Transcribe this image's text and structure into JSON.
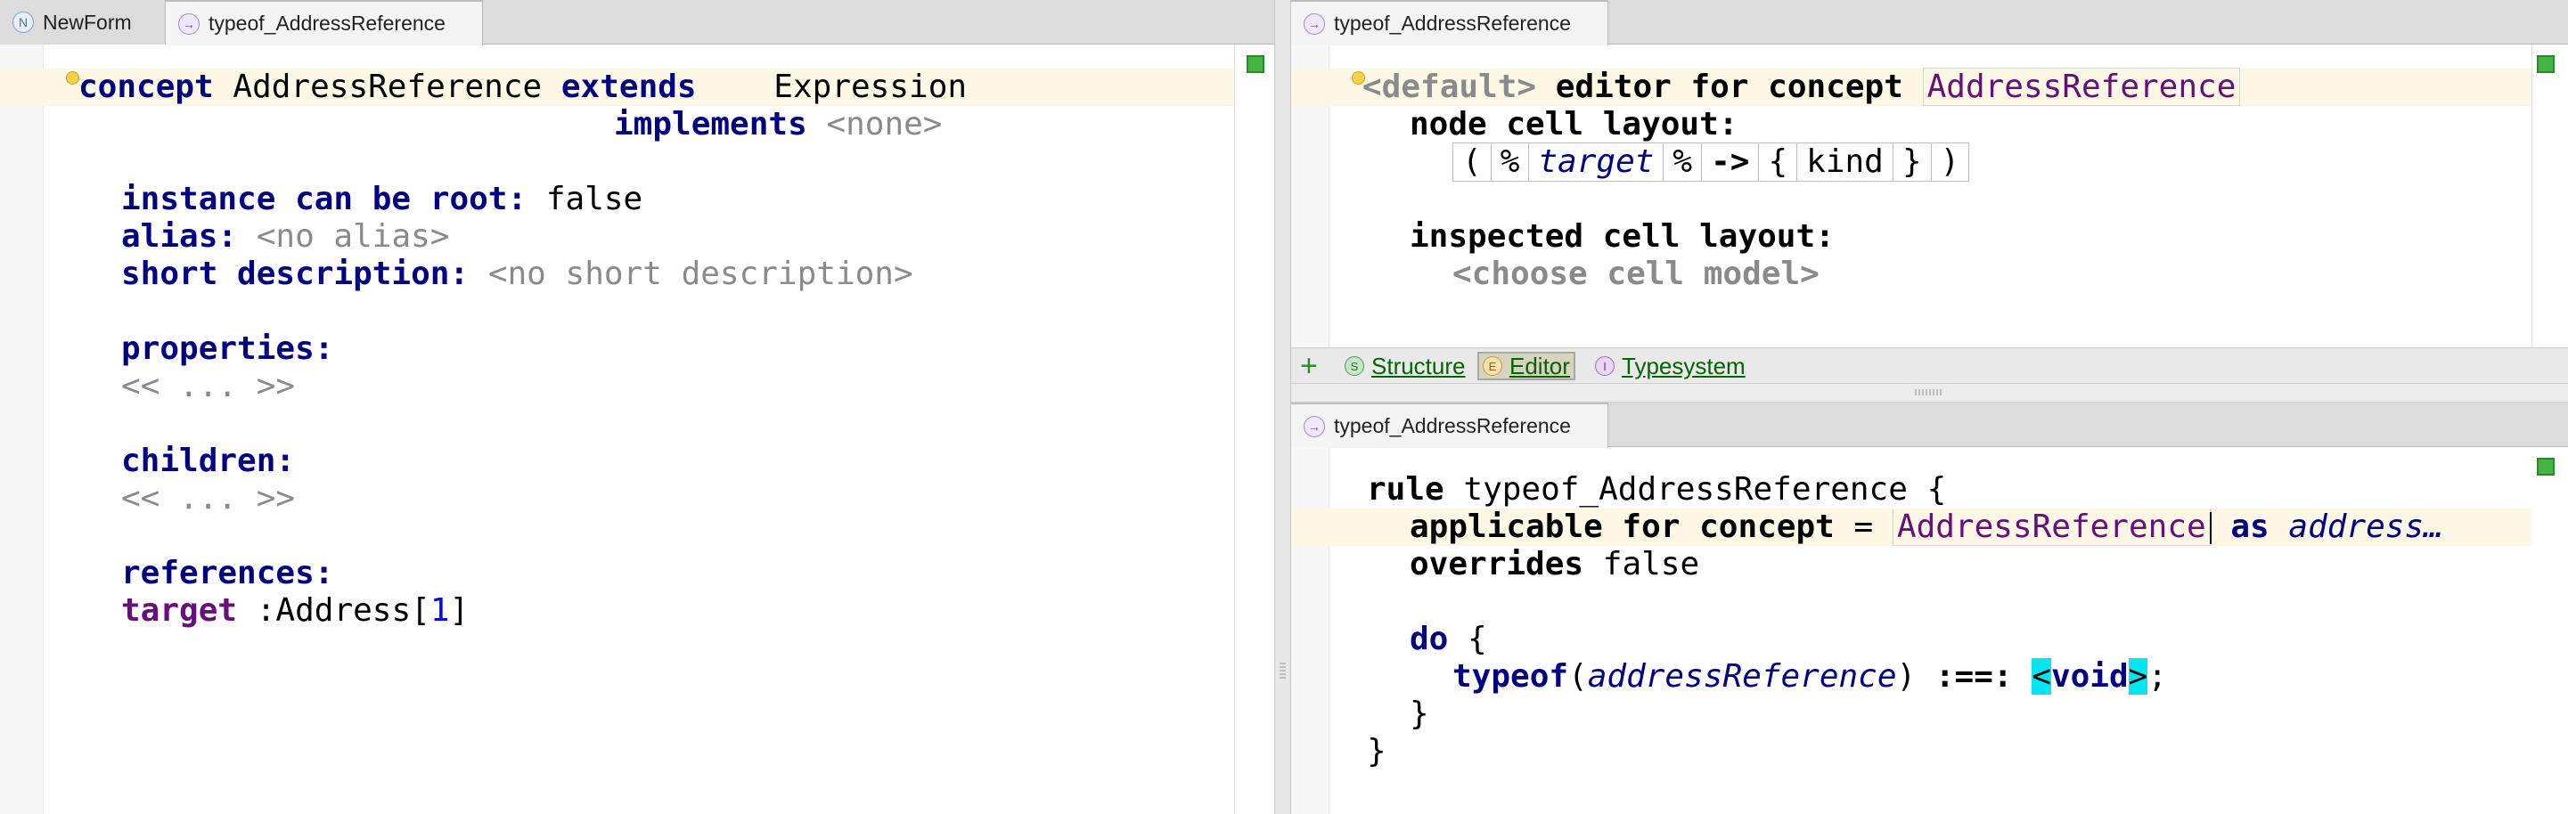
{
  "left": {
    "tabs": [
      {
        "label": "NewForm",
        "icon": "N"
      },
      {
        "label": "typeof_AddressReference",
        "icon": "→"
      }
    ],
    "concept_kw": "concept",
    "concept_name": "AddressReference",
    "extends_kw": "extends",
    "extends_value": "Expression",
    "implements_kw": "implements",
    "implements_value": "<none>",
    "root_label": "instance can be root:",
    "root_value": "false",
    "alias_label": "alias:",
    "alias_value": "<no alias>",
    "shortdesc_label": "short description:",
    "shortdesc_value": "<no short description>",
    "properties_label": "properties:",
    "properties_value": "<< ... >>",
    "children_label": "children:",
    "children_value": "<< ... >>",
    "references_label": "references:",
    "ref_name": "target",
    "ref_colon": ":",
    "ref_type": "Address",
    "ref_bracket_open": "[",
    "ref_card": "1",
    "ref_bracket_close": "]"
  },
  "editor_pane": {
    "tab_label": "typeof_AddressReference",
    "default_text": "<default>",
    "editor_for_concept": "editor for concept",
    "concept_ref": "AddressReference",
    "node_cell_layout": "node cell layout:",
    "cells": [
      "(",
      "%",
      "target",
      "%",
      "->",
      "{",
      "kind",
      "}",
      ")"
    ],
    "inspected_cell_layout": "inspected cell layout:",
    "choose_cell_model": "<choose cell model>",
    "aspect_add": "+",
    "aspects": [
      {
        "label": "Structure",
        "icon": "S",
        "active": false
      },
      {
        "label": "Editor",
        "icon": "E",
        "active": true
      },
      {
        "label": "Typesystem",
        "icon": "I",
        "active": false
      }
    ]
  },
  "rule_pane": {
    "tab_label": "typeof_AddressReference",
    "rule_kw": "rule",
    "rule_name": "typeof_AddressReference",
    "open_brace": "{",
    "applicable_kw": "applicable for concept",
    "equals": "=",
    "concept_ref": "AddressReference",
    "as_kw": "as",
    "as_name": "address…",
    "overrides_kw": "overrides",
    "overrides_value": "false",
    "do_kw": "do",
    "do_brace": "{",
    "typeof_kw": "typeof",
    "typeof_arg": "addressReference",
    "equation_op": ":==:",
    "lt": "<",
    "void_kw": "void",
    "gt": ">",
    "semicolon": ";",
    "inner_close": "}",
    "outer_close": "}"
  },
  "colors": {
    "keyword": "#000080",
    "concept_ref": "#660e7a",
    "ok_status": "#44b541",
    "highlight": "#00e5ef"
  }
}
